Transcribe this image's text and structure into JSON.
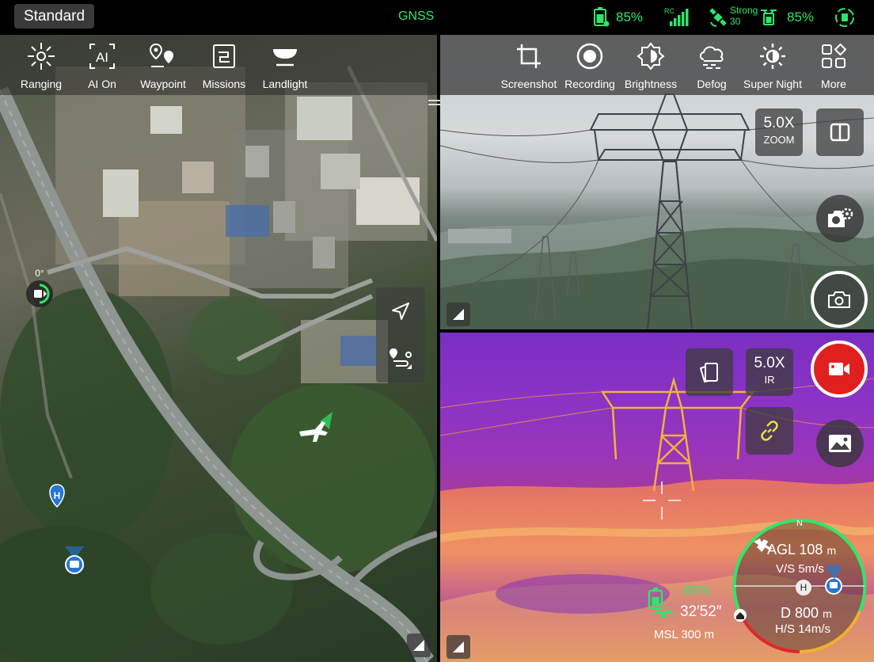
{
  "status_bar": {
    "mode_label": "Standard",
    "positioning": "GNSS",
    "remote_battery": "85%",
    "rc_label": "RC",
    "signal_strength_label": "Strong",
    "satellites": "30",
    "aircraft_battery": "85%",
    "accent_color": "#2ee66b"
  },
  "map_toolbar": {
    "items": [
      {
        "label": "Ranging",
        "icon": "ranging-icon"
      },
      {
        "label": "AI On",
        "icon": "ai-icon"
      },
      {
        "label": "Waypoint",
        "icon": "waypoint-icon"
      },
      {
        "label": "Missions",
        "icon": "missions-icon"
      },
      {
        "label": "Landlight",
        "icon": "landlight-icon"
      }
    ]
  },
  "map": {
    "heading": "0°",
    "home_marker": "H"
  },
  "camera_toolbar": {
    "items": [
      {
        "label": "Screenshot",
        "icon": "crop-icon"
      },
      {
        "label": "Recording",
        "icon": "record-icon"
      },
      {
        "label": "Brightness",
        "icon": "brightness-icon"
      },
      {
        "label": "Defog",
        "icon": "defog-icon"
      },
      {
        "label": "Super Night",
        "icon": "super-night-icon"
      },
      {
        "label": "More",
        "icon": "more-grid-icon"
      }
    ]
  },
  "zoom_camera": {
    "zoom_value": "5.0X",
    "zoom_unit": "ZOOM"
  },
  "ir_camera": {
    "zoom_value": "5.0X",
    "zoom_unit": "IR"
  },
  "telemetry": {
    "battery": "85%",
    "flight_time": "32′52″",
    "msl_label": "MSL",
    "msl_value": "300 m",
    "agl_label": "AGL",
    "agl_value": "108",
    "agl_unit": "m",
    "vs_label": "V/S",
    "vs_value": "5m/s",
    "distance_label": "D",
    "distance_value": "800",
    "distance_unit": "m",
    "hs_label": "H/S",
    "hs_value": "14m/s",
    "north": "N",
    "home": "H"
  }
}
